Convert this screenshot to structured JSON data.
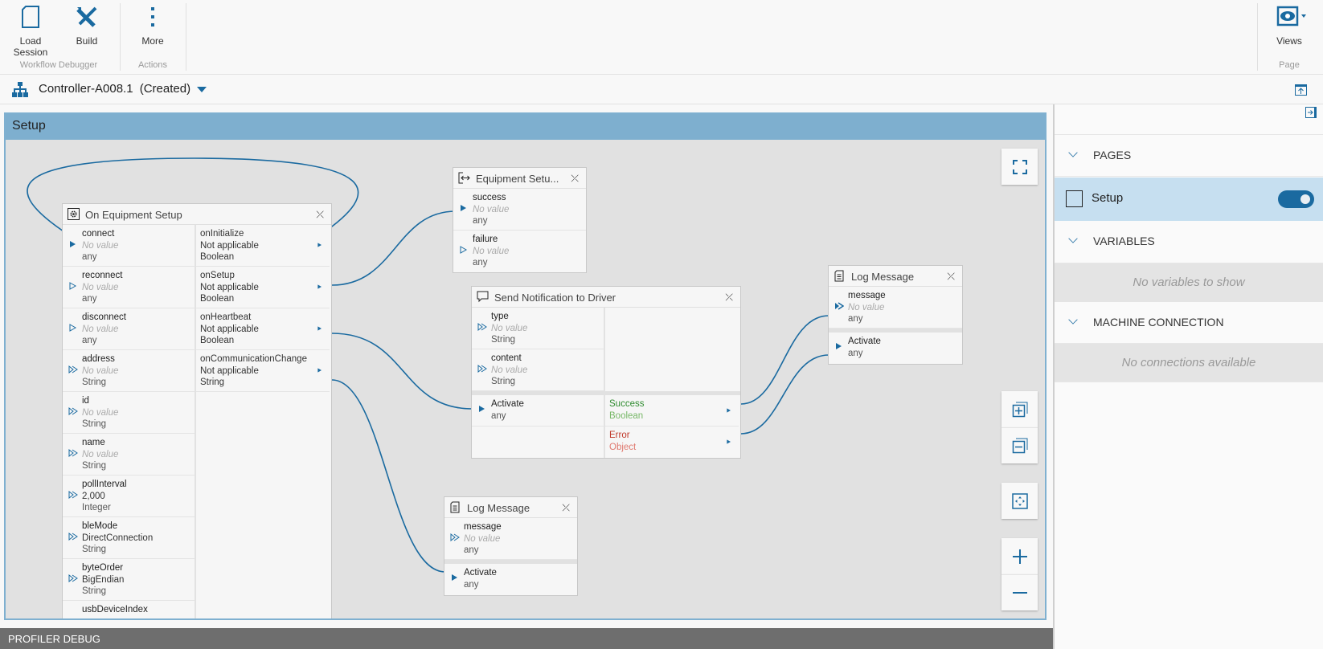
{
  "toolbar": {
    "load_session": "Load Session",
    "build": "Build",
    "more": "More",
    "views": "Views",
    "groups": {
      "workflow_debugger": "Workflow Debugger",
      "actions": "Actions",
      "page": "Page"
    }
  },
  "breadcrumb": {
    "controller": "Controller-A008.1",
    "state": "(Created)"
  },
  "canvas": {
    "page_title": "Setup"
  },
  "profiler": {
    "label": "PROFILER DEBUG"
  },
  "right_panel": {
    "pages_label": "PAGES",
    "pages": [
      {
        "label": "Setup",
        "enabled": true
      }
    ],
    "variables_label": "VARIABLES",
    "variables_empty": "No variables to show",
    "machine_connection_label": "MACHINE CONNECTION",
    "machine_connection_empty": "No connections available"
  },
  "colors": {
    "accent": "#1a6aa0",
    "header": "#7eafcf",
    "success": "#2e8b2e",
    "error": "#c0392b"
  },
  "nodes": [
    {
      "id": "oes",
      "title": "On Equipment Setup",
      "icon": "gear-icon",
      "inputs": [
        {
          "name": "connect",
          "value": "No value",
          "empty": true,
          "type": "any",
          "port": "filled"
        },
        {
          "name": "reconnect",
          "value": "No value",
          "empty": true,
          "type": "any",
          "port": "outline"
        },
        {
          "name": "disconnect",
          "value": "No value",
          "empty": true,
          "type": "any",
          "port": "outline"
        },
        {
          "name": "address",
          "value": "No value",
          "empty": true,
          "type": "String",
          "port": "list"
        },
        {
          "name": "id",
          "value": "No value",
          "empty": true,
          "type": "String",
          "port": "list"
        },
        {
          "name": "name",
          "value": "No value",
          "empty": true,
          "type": "String",
          "port": "list"
        },
        {
          "name": "pollInterval",
          "value": "2,000",
          "empty": false,
          "type": "Integer",
          "port": "list"
        },
        {
          "name": "bleMode",
          "value": "DirectConnection",
          "empty": false,
          "type": "String",
          "port": "list"
        },
        {
          "name": "byteOrder",
          "value": "BigEndian",
          "empty": false,
          "type": "String",
          "port": "list"
        },
        {
          "name": "usbDeviceIndex",
          "value": "",
          "empty": true,
          "type": "",
          "port": "none"
        }
      ],
      "outputs": [
        {
          "name": "onInitialize",
          "value": "Not applicable",
          "type": "Boolean"
        },
        {
          "name": "onSetup",
          "value": "Not applicable",
          "type": "Boolean"
        },
        {
          "name": "onHeartbeat",
          "value": "Not applicable",
          "type": "Boolean"
        },
        {
          "name": "onCommunicationChange",
          "value": "Not applicable",
          "type": "String"
        }
      ]
    },
    {
      "id": "eqs",
      "title": "Equipment Setu...",
      "icon": "exit-icon",
      "inputs": [
        {
          "name": "success",
          "value": "No value",
          "empty": true,
          "type": "any",
          "port": "filled"
        },
        {
          "name": "failure",
          "value": "No value",
          "empty": true,
          "type": "any",
          "port": "outline"
        }
      ]
    },
    {
      "id": "snd",
      "title": "Send Notification to Driver",
      "icon": "chat-icon",
      "inputs": [
        {
          "name": "type",
          "value": "No value",
          "empty": true,
          "type": "String",
          "port": "list"
        },
        {
          "name": "content",
          "value": "No value",
          "empty": true,
          "type": "String",
          "port": "list"
        }
      ],
      "activate": {
        "name": "Activate",
        "type": "any"
      },
      "results": [
        {
          "name": "Success",
          "type": "Boolean",
          "status": "ok"
        },
        {
          "name": "Error",
          "type": "Object",
          "status": "err"
        }
      ]
    },
    {
      "id": "log1",
      "title": "Log Message",
      "icon": "document-icon",
      "inputs": [
        {
          "name": "message",
          "value": "No value",
          "empty": true,
          "type": "any",
          "port": "list-filled"
        }
      ],
      "activate": {
        "name": "Activate",
        "type": "any"
      }
    },
    {
      "id": "log2",
      "title": "Log Message",
      "icon": "document-icon",
      "inputs": [
        {
          "name": "message",
          "value": "No value",
          "empty": true,
          "type": "any",
          "port": "list"
        }
      ],
      "activate": {
        "name": "Activate",
        "type": "any"
      }
    }
  ]
}
